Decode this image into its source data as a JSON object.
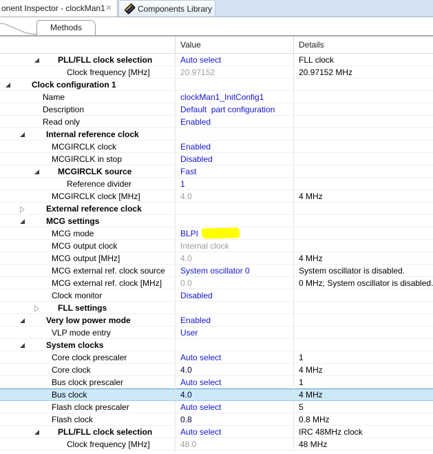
{
  "window": {
    "editor_tab": {
      "label": "onent Inspector - clockMan1",
      "close_icon": "✕"
    },
    "library_tab": {
      "label": "Components Library",
      "icon": "component-chip-icon"
    },
    "methods_tab": {
      "label": "Methods"
    }
  },
  "colors": {
    "tabstrip_bg": "#d3e2f2",
    "value_blue": "#1414d2",
    "value_gray": "#9d9d9d",
    "value_dark": "#00003c",
    "selection_bg": "#cde9f8",
    "selection_border": "#5ea7d8",
    "highlight_yellow": "#ffff00"
  },
  "table": {
    "columns": {
      "name": "",
      "value": "Value",
      "details": "Details"
    },
    "rows": [
      {
        "name": "PLL/FLL clock selection",
        "level": 2,
        "kind": "group-open",
        "value": "Auto select",
        "value_color": "blue",
        "details": "FLL clock"
      },
      {
        "name": "Clock frequency [MHz]",
        "level": 3,
        "kind": "leaf",
        "value": "20.97152",
        "value_color": "gray",
        "details": "20.97152 MHz"
      },
      {
        "name": "Clock configuration 1",
        "level": 0,
        "kind": "group-open",
        "value": "",
        "value_color": "blue",
        "details": ""
      },
      {
        "name": "Name",
        "level": 1,
        "kind": "leaf",
        "value": "clockMan1_InitConfig1",
        "value_color": "blue",
        "details": ""
      },
      {
        "name": "Description",
        "level": 1,
        "kind": "leaf",
        "value": "Default  part configuration",
        "value_color": "blue",
        "details": ""
      },
      {
        "name": "Read only",
        "level": 1,
        "kind": "leaf",
        "value": "Enabled",
        "value_color": "blue",
        "details": ""
      },
      {
        "name": "Internal reference clock",
        "level": 1,
        "kind": "group-open",
        "value": "",
        "value_color": "blue",
        "details": ""
      },
      {
        "name": "MCGIRCLK clock",
        "level": 2,
        "kind": "leaf",
        "value": "Enabled",
        "value_color": "blue",
        "details": ""
      },
      {
        "name": "MCGIRCLK in stop",
        "level": 2,
        "kind": "leaf",
        "value": "Disabled",
        "value_color": "blue",
        "details": ""
      },
      {
        "name": "MCGIRCLK source",
        "level": 2,
        "kind": "group-open",
        "value": "Fast",
        "value_color": "blue",
        "details": ""
      },
      {
        "name": "Reference divider",
        "level": 3,
        "kind": "leaf",
        "value": "1",
        "value_color": "blue",
        "details": ""
      },
      {
        "name": "MCGIRCLK clock [MHz]",
        "level": 2,
        "kind": "leaf",
        "value": "4.0",
        "value_color": "gray",
        "details": "4 MHz"
      },
      {
        "name": "External reference clock",
        "level": 1,
        "kind": "group-closed",
        "value": "",
        "value_color": "blue",
        "details": ""
      },
      {
        "name": "MCG settings",
        "level": 1,
        "kind": "group-open",
        "value": "",
        "value_color": "blue",
        "details": ""
      },
      {
        "name": "MCG mode",
        "level": 2,
        "kind": "leaf",
        "value": "BLPI",
        "value_color": "blue",
        "details": "",
        "marker": true
      },
      {
        "name": "MCG output clock",
        "level": 2,
        "kind": "leaf",
        "value": "Internal clock",
        "value_color": "gray",
        "details": ""
      },
      {
        "name": "MCG output [MHz]",
        "level": 2,
        "kind": "leaf",
        "value": "4.0",
        "value_color": "gray",
        "details": "4 MHz"
      },
      {
        "name": "MCG external ref. clock source",
        "level": 2,
        "kind": "leaf",
        "value": "System oscillator 0",
        "value_color": "blue",
        "details": "System oscillator is disabled."
      },
      {
        "name": "MCG external ref. clock [MHz]",
        "level": 2,
        "kind": "leaf",
        "value": "0.0",
        "value_color": "gray",
        "details": "0 MHz; System oscillator is disabled."
      },
      {
        "name": "Clock monitor",
        "level": 2,
        "kind": "leaf",
        "value": "Disabled",
        "value_color": "blue",
        "details": ""
      },
      {
        "name": "FLL settings",
        "level": 2,
        "kind": "group-closed",
        "value": "",
        "value_color": "blue",
        "details": ""
      },
      {
        "name": "Very low power mode",
        "level": 1,
        "kind": "group-open",
        "value": "Enabled",
        "value_color": "blue",
        "details": ""
      },
      {
        "name": "VLP mode entry",
        "level": 2,
        "kind": "leaf",
        "value": "User",
        "value_color": "blue",
        "details": ""
      },
      {
        "name": "System clocks",
        "level": 1,
        "kind": "group-open",
        "value": "",
        "value_color": "blue",
        "details": ""
      },
      {
        "name": "Core clock prescaler",
        "level": 2,
        "kind": "leaf",
        "value": "Auto select",
        "value_color": "blue",
        "details": "1"
      },
      {
        "name": "Core clock",
        "level": 2,
        "kind": "leaf",
        "value": "4.0",
        "value_color": "dark",
        "details": "4 MHz"
      },
      {
        "name": "Bus clock prescaler",
        "level": 2,
        "kind": "leaf",
        "value": "Auto select",
        "value_color": "blue",
        "details": "1"
      },
      {
        "name": "Bus clock",
        "level": 2,
        "kind": "leaf",
        "value": "4.0",
        "value_color": "dark",
        "details": "4 MHz",
        "selected": true
      },
      {
        "name": "Flash clock prescaler",
        "level": 2,
        "kind": "leaf",
        "value": "Auto select",
        "value_color": "blue",
        "details": "5"
      },
      {
        "name": "Flash clock",
        "level": 2,
        "kind": "leaf",
        "value": "0.8",
        "value_color": "dark",
        "details": "0.8 MHz"
      },
      {
        "name": "PLL/FLL clock selection",
        "level": 2,
        "kind": "group-open",
        "value": "Auto select",
        "value_color": "blue",
        "details": "IRC 48MHz clock"
      },
      {
        "name": "Clock frequency [MHz]",
        "level": 3,
        "kind": "leaf",
        "value": "48.0",
        "value_color": "gray",
        "details": "48 MHz"
      }
    ]
  }
}
